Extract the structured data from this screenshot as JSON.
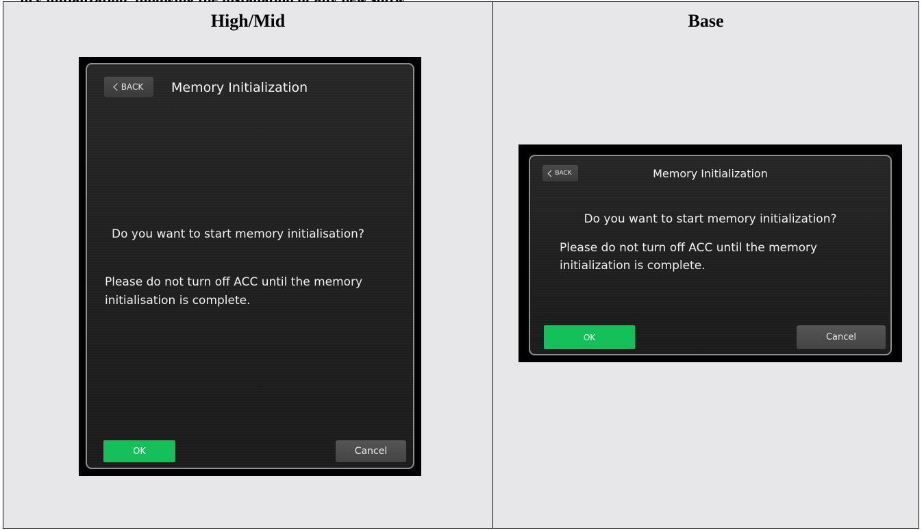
{
  "header_clip": "ory initialization, following the installation of any new softw",
  "columns": [
    {
      "heading": "High/Mid",
      "screen": {
        "back_label": "BACK",
        "title": "Memory Initialization",
        "question": "Do you want to start memory initialisation?",
        "warning": "Please do not turn off ACC until the memory initialisation is complete.",
        "ok_label": "OK",
        "cancel_label": "Cancel"
      }
    },
    {
      "heading": "Base",
      "screen": {
        "back_label": "BACK",
        "title": "Memory Initialization",
        "question": "Do you want to start memory initialization?",
        "warning": "Please do not turn off ACC until the memory initialization is complete.",
        "ok_label": "OK",
        "cancel_label": "Cancel"
      }
    }
  ],
  "colors": {
    "ok_green": "#13c05a",
    "cell_background": "#e7e7e9",
    "screen_background": "#1f1f1f"
  },
  "icons": [
    "back-chevron-icon"
  ]
}
